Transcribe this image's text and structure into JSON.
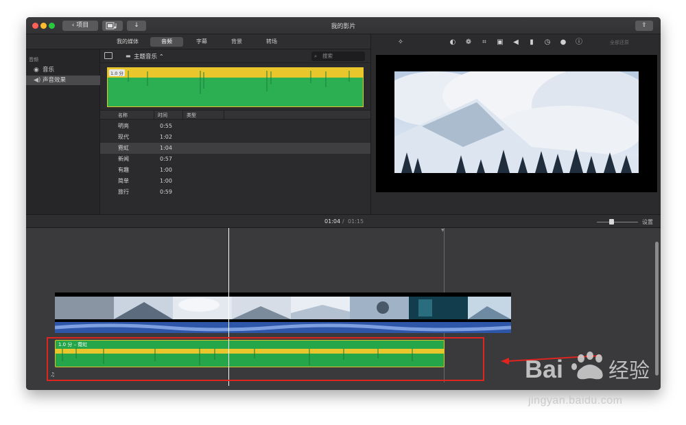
{
  "window": {
    "title": "我的影片",
    "back_label": "项目"
  },
  "tabs": [
    {
      "label": "我的媒体",
      "active": false
    },
    {
      "label": "音频",
      "active": true
    },
    {
      "label": "字幕",
      "active": false
    },
    {
      "label": "背景",
      "active": false
    },
    {
      "label": "转场",
      "active": false
    }
  ],
  "sidebar": {
    "heading": "音频",
    "items": [
      {
        "label": "音乐",
        "icon": "music-disc-icon",
        "selected": false
      },
      {
        "label": "声音效果",
        "icon": "speaker-icon",
        "selected": true
      }
    ]
  },
  "browser": {
    "folder_label": "主题音乐",
    "search_placeholder": "搜索",
    "preview_badge": "1.0 分",
    "columns": [
      "名称",
      "时间",
      "类型"
    ],
    "rows": [
      {
        "name": "明亮",
        "time": "0:55",
        "selected": false
      },
      {
        "name": "现代",
        "time": "1:02",
        "selected": false
      },
      {
        "name": "霓虹",
        "time": "1:04",
        "selected": true
      },
      {
        "name": "新闻",
        "time": "0:57",
        "selected": false
      },
      {
        "name": "有趣",
        "time": "1:00",
        "selected": false
      },
      {
        "name": "简单",
        "time": "1:00",
        "selected": false
      },
      {
        "name": "旅行",
        "time": "0:59",
        "selected": false
      }
    ]
  },
  "viewer": {
    "reset_all_label": "全部还原",
    "tools": [
      "magic-wand-icon",
      "color-balance-icon",
      "color-correction-icon",
      "crop-icon",
      "stabilization-icon",
      "volume-icon",
      "equalizer-icon",
      "speed-icon",
      "filter-icon",
      "info-icon"
    ]
  },
  "timeline": {
    "current_time": "01:04",
    "separator": "/",
    "total_time": "01:15",
    "settings_label": "设置",
    "music_clip_label": "1.0 分 – 霓虹",
    "zoom_level": 0.4
  },
  "watermark": {
    "logo_text": "Bai du 经验",
    "url": "jingyan.baidu.com"
  },
  "colors": {
    "accent_yellow": "#e8c62c",
    "audio_green": "#2cae53",
    "audio_blue": "#2d55a8",
    "highlight_red": "#e0241f"
  }
}
